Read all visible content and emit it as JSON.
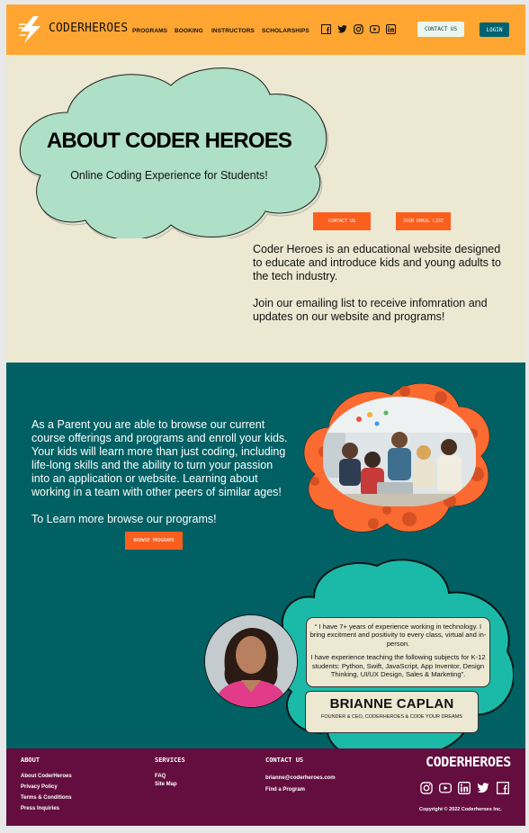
{
  "brand": "CODERHEROES",
  "nav": [
    "PROGRAMS",
    "BOOKING",
    "INSTRUCTORS",
    "SCHOLARSHIPS"
  ],
  "header_buttons": {
    "contact": "CONTACT US",
    "login": "LOGIN"
  },
  "hero": {
    "title": "ABOUT CODER HEROES",
    "subtitle": "Online Coding Experience for Students!",
    "contact_button": "CONTACT US",
    "join_button": "JOIN EMAIL LIST",
    "paragraph1": " Coder Heroes is an educational website designed to educate and introduce kids and young adults to the tech industry.",
    "paragraph2": " Join our emailing list to receive infomration and updates on our website and programs!"
  },
  "parents": {
    "paragraph1": " As a Parent you are able to browse our current course offerings and programs and enroll your kids. Your kids will learn more than just coding, including life-long skills and the ability to turn your passion into an application or website. Learning about working in a team with other peers of similar ages!",
    "paragraph2": "To Learn more browse our programs!",
    "browse_button": "BROWSE PROGRAMS"
  },
  "testimonial": {
    "quote1": "“ I have 7+ years of experience working in technology. I bring excitment and positivity to every class, virtual and in-person.",
    "quote2": "I have experience teaching the following subjects for K-12 students: Python, Swift, JavaScript, App Inventor, Design Thinking, UI/UX Design, Sales & Marketing”.",
    "name": "BRIANNE CAPLAN",
    "role": "FOUNDER & CEO, CODERHEROES & CODE YOUR DREAMS"
  },
  "footer": {
    "about_heading": "ABOUT",
    "about_links": [
      "About CoderHeroes",
      "Privacy Policy",
      "Terms & Conditions",
      "Press Inquiries"
    ],
    "services_heading": "SERVICES",
    "services_links": [
      "FAQ",
      "Site Map"
    ],
    "contact_heading": "CONTACT US",
    "contact_email": "brianne@coderheroes.com",
    "contact_link": "Find a Program",
    "brand": "CODERHEROES",
    "copyright": "Copyright © 2022 Coderheroes Inc."
  },
  "icons": [
    "facebook-icon",
    "twitter-icon",
    "instagram-icon",
    "youtube-icon",
    "linkedin-icon"
  ],
  "colors": {
    "header": "#ffa632",
    "cream": "#ece8d2",
    "teal": "#006063",
    "orange": "#fb5f1e",
    "mint": "#aedfc7",
    "footer": "#630e3f",
    "aqua": "#1bb9a8"
  }
}
